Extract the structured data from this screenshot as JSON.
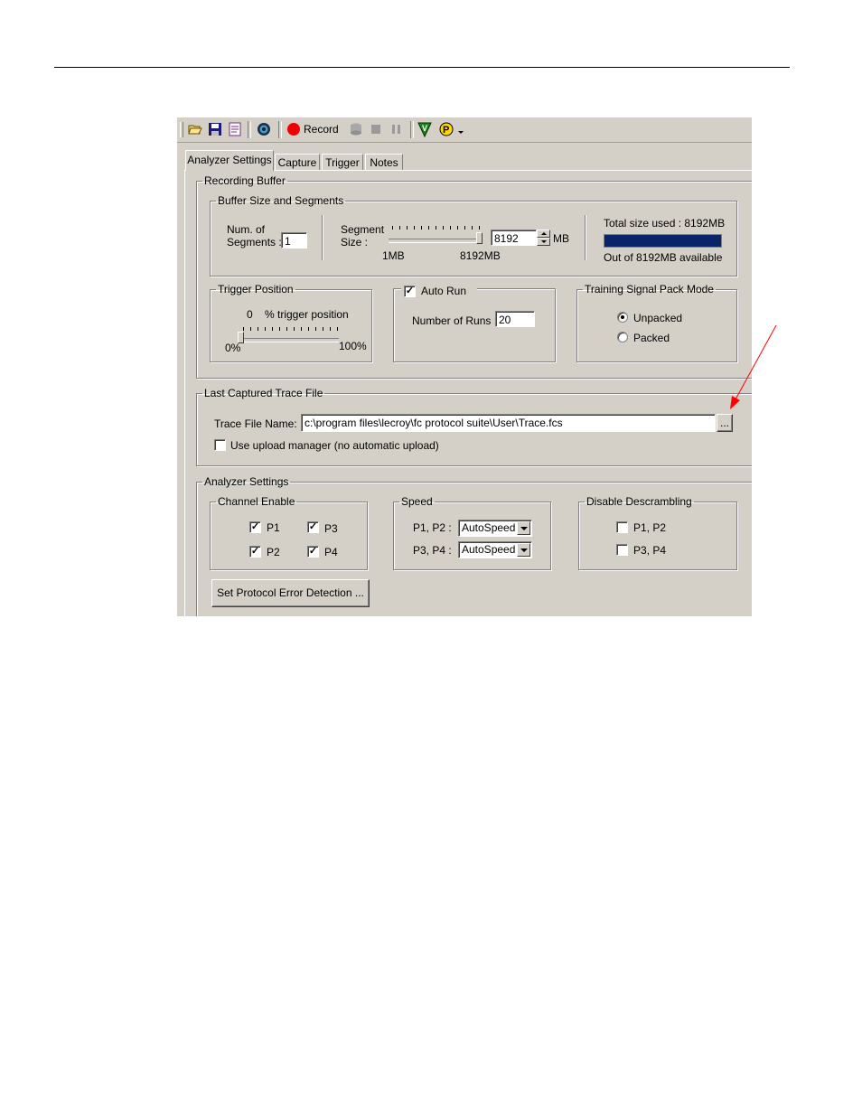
{
  "toolbar": {
    "record_label": "Record",
    "icons": [
      "open-folder-icon",
      "save-icon",
      "report-icon",
      "target-icon",
      "record-icon",
      "database-icon",
      "stop-icon",
      "pause-icon",
      "verify-icon",
      "p-icon",
      "dropdown-arrow-icon"
    ],
    "colors": {
      "record": "#f00000",
      "verify": "#1a8a1a",
      "p_button": "#ffd800"
    }
  },
  "tabs": [
    {
      "label": "Analyzer Settings",
      "active": true
    },
    {
      "label": "Capture",
      "active": false
    },
    {
      "label": "Trigger",
      "active": false
    },
    {
      "label": "Notes",
      "active": false
    }
  ],
  "recording_buffer": {
    "title": "Recording Buffer",
    "buffer": {
      "title": "Buffer Size and Segments",
      "num_segments_label_1": "Num. of",
      "num_segments_label_2": "Segments :",
      "num_segments_value": "1",
      "segment_size_label_1": "Segment",
      "segment_size_label_2": "Size :",
      "slider_min": "1MB",
      "slider_max": "8192MB",
      "segment_size_value": "8192",
      "segment_size_unit": "MB",
      "total_size_text": "Total size used : 8192MB",
      "usage_fraction": 1.0,
      "usage_color": "#0a246a",
      "available_text": "Out of 8192MB available"
    },
    "trigger_position": {
      "title": "Trigger Position",
      "value": "0",
      "value_label": "% trigger position",
      "min": "0%",
      "max": "100%",
      "fraction": 0.0
    },
    "auto_run": {
      "label": "Auto Run",
      "checked": true,
      "runs_label": "Number of Runs :",
      "runs_value": "20"
    },
    "pack_mode": {
      "title": "Training Signal Pack Mode",
      "unpacked_label": "Unpacked",
      "packed_label": "Packed",
      "selected": "Unpacked"
    }
  },
  "trace_file": {
    "title": "Last Captured Trace File",
    "name_label": "Trace File Name:",
    "path_value": "c:\\program files\\lecroy\\fc protocol suite\\User\\Trace.fcs",
    "browse_label": "...",
    "upload_label": "Use upload manager (no automatic upload)",
    "upload_checked": false
  },
  "analyzer_settings": {
    "title": "Analyzer Settings",
    "channel_enable": {
      "title": "Channel Enable",
      "channels": [
        {
          "label": "P1",
          "checked": true
        },
        {
          "label": "P3",
          "checked": true
        },
        {
          "label": "P2",
          "checked": true
        },
        {
          "label": "P4",
          "checked": true
        }
      ]
    },
    "speed": {
      "title": "Speed",
      "p12_label": "P1, P2 :",
      "p12_value": "AutoSpeed",
      "p34_label": "P3, P4 :",
      "p34_value": "AutoSpeed"
    },
    "descrambling": {
      "title": "Disable Descrambling",
      "p12_label": "P1, P2",
      "p12_checked": false,
      "p34_label": "P3, P4",
      "p34_checked": false
    },
    "error_button_label": "Set Protocol Error Detection ..."
  },
  "annotation": {
    "arrow_color": "#ff0000"
  }
}
